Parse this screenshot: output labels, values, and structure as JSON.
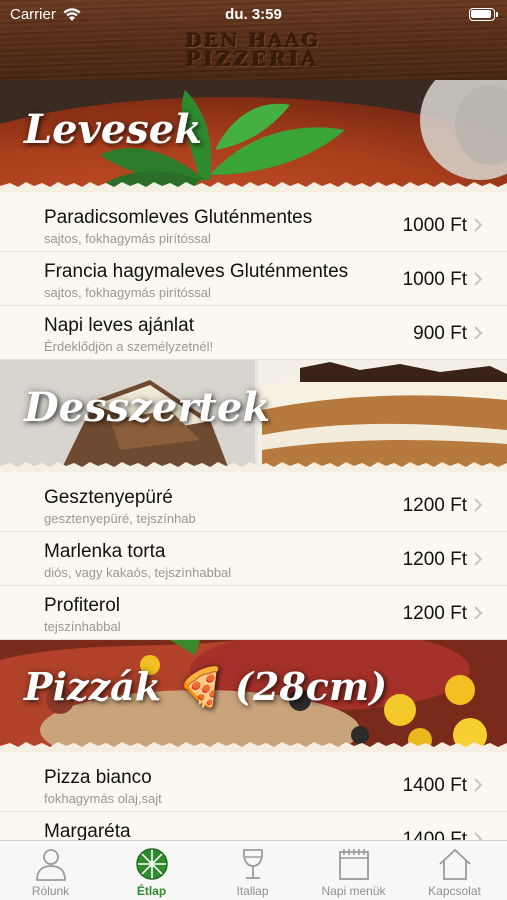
{
  "status_bar": {
    "carrier": "Carrier",
    "time": "du. 3:59"
  },
  "header": {
    "logo_line1": "DEN HAAG",
    "logo_line2": "PIZZERIA"
  },
  "sections": [
    {
      "title": "Levesek",
      "items": [
        {
          "name": "Paradicsomleves Gluténmentes",
          "desc": "sajtos, fokhagymás pirítóssal",
          "price": "1000 Ft"
        },
        {
          "name": "Francia hagymaleves Gluténmentes",
          "desc": "sajtos, fokhagymás pirítóssal",
          "price": "1000 Ft"
        },
        {
          "name": "Napi leves ajánlat",
          "desc": "Érdeklődjön a személyzetnél!",
          "price": "900 Ft"
        }
      ]
    },
    {
      "title": "Desszertek",
      "items": [
        {
          "name": "Gesztenyepüré",
          "desc": "gesztenyepüré, tejszínhab",
          "price": "1200 Ft"
        },
        {
          "name": "Marlenka torta",
          "desc": "diós, vagy kakaós, tejszínhabbal",
          "price": "1200 Ft"
        },
        {
          "name": "Profiterol",
          "desc": "tejszínhabbal",
          "price": "1200 Ft"
        }
      ]
    },
    {
      "title": "Pizzák 🍕 (28cm)",
      "items": [
        {
          "name": "Pizza bianco",
          "desc": "fokhagymás olaj,sajt",
          "price": "1400 Ft"
        },
        {
          "name": "Margaréta",
          "desc": "",
          "price": "1400 Ft"
        }
      ]
    }
  ],
  "tabbar": [
    {
      "label": "Rólunk",
      "icon": "person-icon",
      "active": false
    },
    {
      "label": "Étlap",
      "icon": "pizza-icon",
      "active": true
    },
    {
      "label": "Itallap",
      "icon": "wine-glass-icon",
      "active": false
    },
    {
      "label": "Napi menük",
      "icon": "calendar-icon",
      "active": false
    },
    {
      "label": "Kapcsolat",
      "icon": "house-icon",
      "active": false
    }
  ],
  "colors": {
    "accent_green": "#2e8b2e",
    "wood": "#5a2f18",
    "row_bg": "#fbf9ef"
  }
}
